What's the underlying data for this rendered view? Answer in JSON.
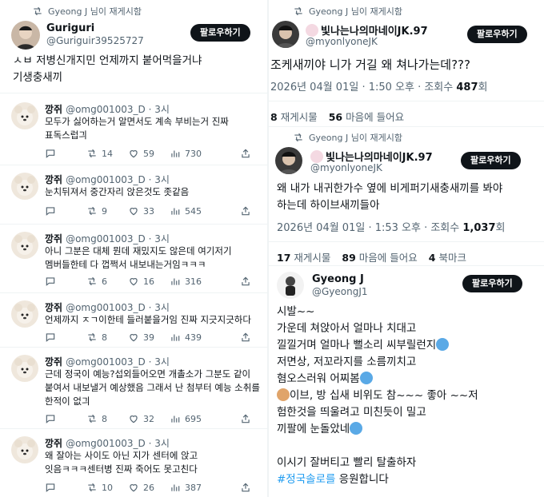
{
  "left": {
    "retweet_label": "Gyeong J 님이 재게시함",
    "author": {
      "name": "Guriguri",
      "handle": "@Guriguir39525727"
    },
    "follow_label": "팔로우하기",
    "text_lines": [
      "ㅅㅂ 저병신개지민 언제까지 붙어먹을거냐",
      "기생충새끼"
    ],
    "replies": [
      {
        "name": "깡쥐",
        "handle": "@omg001003_D",
        "time": "· 3시",
        "lines": [
          "모두가 싫어하는거 알면서도 계속 부비는거 진짜",
          "표독스럽긔"
        ],
        "reply": "",
        "retweets": "14",
        "likes": "59",
        "views": "730"
      },
      {
        "name": "깡쥐",
        "handle": "@omg001003_D",
        "time": "· 3시",
        "lines": [
          "눈치뒤져서 중간자리 앉은것도 좃같음"
        ],
        "reply": "",
        "retweets": "9",
        "likes": "33",
        "views": "545"
      },
      {
        "name": "깡쥐",
        "handle": "@omg001003_D",
        "time": "· 3시",
        "lines": [
          "아니 그분은 대체 뭔데 재밌지도 않은데 여기저기",
          "멤버들한테 다 껍쩍서 내보내는거임ㅋㅋㅋ"
        ],
        "reply": "",
        "retweets": "6",
        "likes": "16",
        "views": "316"
      },
      {
        "name": "깡쥐",
        "handle": "@omg001003_D",
        "time": "· 3시",
        "lines": [
          "언제까지 ㅈㄱ이한테 들러붙을거임 진짜 지긋지긋하다"
        ],
        "reply": "",
        "retweets": "8",
        "likes": "39",
        "views": "439"
      },
      {
        "name": "깡쥐",
        "handle": "@omg001003_D",
        "time": "· 3시",
        "lines": [
          "근데 정국이 예능?섭외들어오면 개촐소가 그분도 같이",
          "붙여서 내보낼거 예상했음 그래서 난 첨부터 예능 소취를",
          "한적이 없긔"
        ],
        "reply": "",
        "retweets": "8",
        "likes": "32",
        "views": "695"
      },
      {
        "name": "깡쥐",
        "handle": "@omg001003_D",
        "time": "· 3시",
        "lines": [
          "왜 잘아는 사이도 아닌 지가 센터에 앉고",
          "잇음ㅋㅋㅋ센터병 진짜 죽어도 못고친다"
        ],
        "reply": "",
        "retweets": "10",
        "likes": "26",
        "views": "387"
      }
    ]
  },
  "right": {
    "post1": {
      "retweet_label": "Gyeong J 님이 재게시함",
      "name": "빛나는나의마네이JK.97",
      "handle": "@myonlyoneJK",
      "follow_label": "팔로우하기",
      "text": "조케새끼야 니가 거길 왜 쳐나가는데???",
      "date": "2026년 04월 01일 · 1:50 오후 · 조회수",
      "views": "487",
      "views_unit": "회",
      "reposts_count": "8",
      "reposts_label": "재게시물",
      "likes_count": "56",
      "likes_label": "마음에 들어요"
    },
    "post2": {
      "retweet_label": "Gyeong J 님이 재게시함",
      "name": "빛나는나의마네이JK.97",
      "handle": "@myonlyoneJK",
      "follow_label": "팔로우하기",
      "text_lines": [
        "왜 내가 내귀한가수 옆에 비게퍼기새충새끼를 봐야",
        "하는데 하이브새끼들아"
      ],
      "date": "2026년 04월 01일 · 1:53 오후 · 조회수",
      "views": "1,037",
      "views_unit": "회",
      "reposts_count": "17",
      "reposts_label": "재게시물",
      "likes_count": "89",
      "likes_label": "마음에 들어요",
      "bookmarks_count": "4",
      "bookmarks_label": "북마크"
    },
    "post3": {
      "name": "Gyeong J",
      "handle": "@GyeongJ1",
      "follow_label": "팔로우하기",
      "lines": [
        "시발~~",
        "가운데 쳐앉아서 얼마나 치대고",
        "낄낄거며 얼마나 뻘소리 씨부릴런지",
        "저면상, 저꼬라지를 소름끼치고",
        "혐오스러워 어찌봄",
        "이브, 방 십새 비위도 참~~~ 좋아 ~~저",
        "험한것을 띄울려고 미친듯이 밀고",
        "끼팔에 눈돌았네",
        "",
        "이시기 잘버티고 빨리 탈출하자"
      ],
      "hashtag": "#정국솔로를",
      "hashtag_suffix": " 응원합니다"
    }
  },
  "colors": {
    "accent": "#1d9bf0",
    "text": "#0f1419",
    "muted": "#536471",
    "button": "#0f1419"
  },
  "icons": [
    "retweet-icon",
    "reply-icon",
    "like-icon",
    "views-icon",
    "share-icon",
    "bunny-emoji",
    "scream-emoji",
    "dog-emoji",
    "pig-emoji"
  ]
}
